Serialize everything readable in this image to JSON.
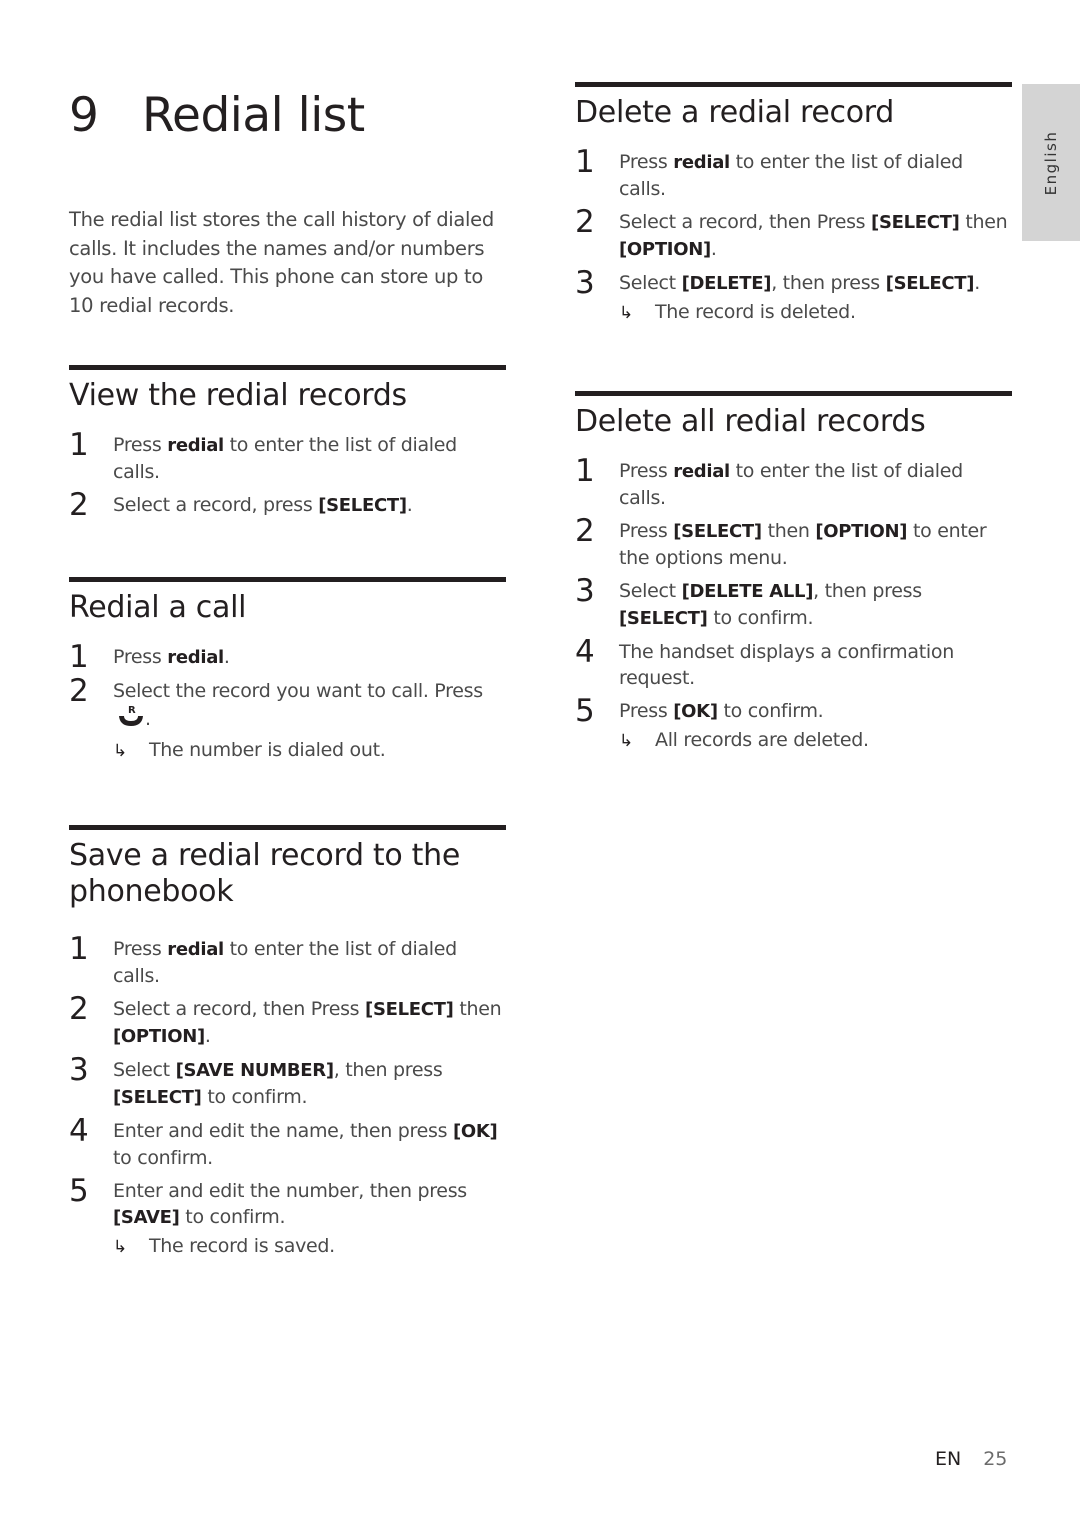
{
  "chapter": {
    "number": "9",
    "title": "Redial list",
    "intro": "The redial list stores the call history of dialed calls. It includes the names and/or numbers you have called. This phone can store up to 10 redial records."
  },
  "sections": [
    {
      "id": "view",
      "title": "View the redial records",
      "steps": [
        {
          "num": "1",
          "runs": [
            [
              "Press ",
              false
            ],
            [
              "redial",
              true
            ],
            [
              " to enter the list of dialed calls.",
              false
            ]
          ]
        },
        {
          "num": "2",
          "runs": [
            [
              "Select a record, press ",
              false
            ],
            [
              "[SELECT]",
              true
            ],
            [
              ".",
              false
            ]
          ]
        }
      ],
      "result": null
    },
    {
      "id": "redial-call",
      "title": "Redial a call",
      "steps": [
        {
          "num": "1",
          "runs": [
            [
              "Press ",
              false
            ],
            [
              "redial",
              true
            ],
            [
              ".",
              false
            ]
          ]
        },
        {
          "num": "2",
          "runs": [
            [
              "Select the record you want to call. Press ",
              false
            ]
          ],
          "icon": "redial-call-icon",
          "after_icon": "."
        }
      ],
      "result": "The number is dialed out."
    },
    {
      "id": "save",
      "title": "Save a redial record to the phonebook",
      "steps": [
        {
          "num": "1",
          "runs": [
            [
              "Press ",
              false
            ],
            [
              "redial",
              true
            ],
            [
              " to enter the list of dialed calls.",
              false
            ]
          ]
        },
        {
          "num": "2",
          "runs": [
            [
              "Select a record, then Press ",
              false
            ],
            [
              "[SELECT]",
              true
            ],
            [
              " then ",
              false
            ],
            [
              "[OPTION]",
              true
            ],
            [
              ".",
              false
            ]
          ]
        },
        {
          "num": "3",
          "runs": [
            [
              "Select ",
              false
            ],
            [
              "[SAVE NUMBER]",
              true
            ],
            [
              ", then press ",
              false
            ],
            [
              "[SELECT]",
              true
            ],
            [
              " to confirm.",
              false
            ]
          ]
        },
        {
          "num": "4",
          "runs": [
            [
              "Enter and edit the name, then press ",
              false
            ],
            [
              "[OK]",
              true
            ],
            [
              " to confirm.",
              false
            ]
          ]
        },
        {
          "num": "5",
          "runs": [
            [
              "Enter and edit the number, then press ",
              false
            ],
            [
              "[SAVE]",
              true
            ],
            [
              " to confirm.",
              false
            ]
          ]
        }
      ],
      "result": "The record is saved."
    },
    {
      "id": "delete-one",
      "title": "Delete a redial record",
      "steps": [
        {
          "num": "1",
          "runs": [
            [
              "Press ",
              false
            ],
            [
              "redial",
              true
            ],
            [
              " to enter the list of dialed calls.",
              false
            ]
          ]
        },
        {
          "num": "2",
          "runs": [
            [
              "Select a record, then Press ",
              false
            ],
            [
              "[SELECT]",
              true
            ],
            [
              " then ",
              false
            ],
            [
              "[OPTION]",
              true
            ],
            [
              ".",
              false
            ]
          ]
        },
        {
          "num": "3",
          "runs": [
            [
              "Select ",
              false
            ],
            [
              "[DELETE]",
              true
            ],
            [
              ", then press ",
              false
            ],
            [
              "[SELECT]",
              true
            ],
            [
              ".",
              false
            ]
          ]
        }
      ],
      "result": "The record is deleted."
    },
    {
      "id": "delete-all",
      "title": "Delete all redial records",
      "steps": [
        {
          "num": "1",
          "runs": [
            [
              "Press ",
              false
            ],
            [
              "redial",
              true
            ],
            [
              " to enter the list of dialed calls.",
              false
            ]
          ]
        },
        {
          "num": "2",
          "runs": [
            [
              "Press ",
              false
            ],
            [
              "[SELECT]",
              true
            ],
            [
              " then ",
              false
            ],
            [
              "[OPTION]",
              true
            ],
            [
              " to enter the options menu.",
              false
            ]
          ]
        },
        {
          "num": "3",
          "runs": [
            [
              "Select ",
              false
            ],
            [
              "[DELETE ALL]",
              true
            ],
            [
              ", then press ",
              false
            ],
            [
              "[SELECT]",
              true
            ],
            [
              " to confirm.",
              false
            ]
          ]
        },
        {
          "num": "4",
          "runs": [
            [
              "The handset displays a confirmation request.",
              false
            ]
          ]
        },
        {
          "num": "5",
          "runs": [
            [
              "Press ",
              false
            ],
            [
              "[OK]",
              true
            ],
            [
              " to confirm.",
              false
            ]
          ]
        }
      ],
      "result": "All records are deleted."
    }
  ],
  "result_arrow_glyph": "↳",
  "side_tab": {
    "label": "English"
  },
  "footer": {
    "lang": "EN",
    "page": "25"
  }
}
